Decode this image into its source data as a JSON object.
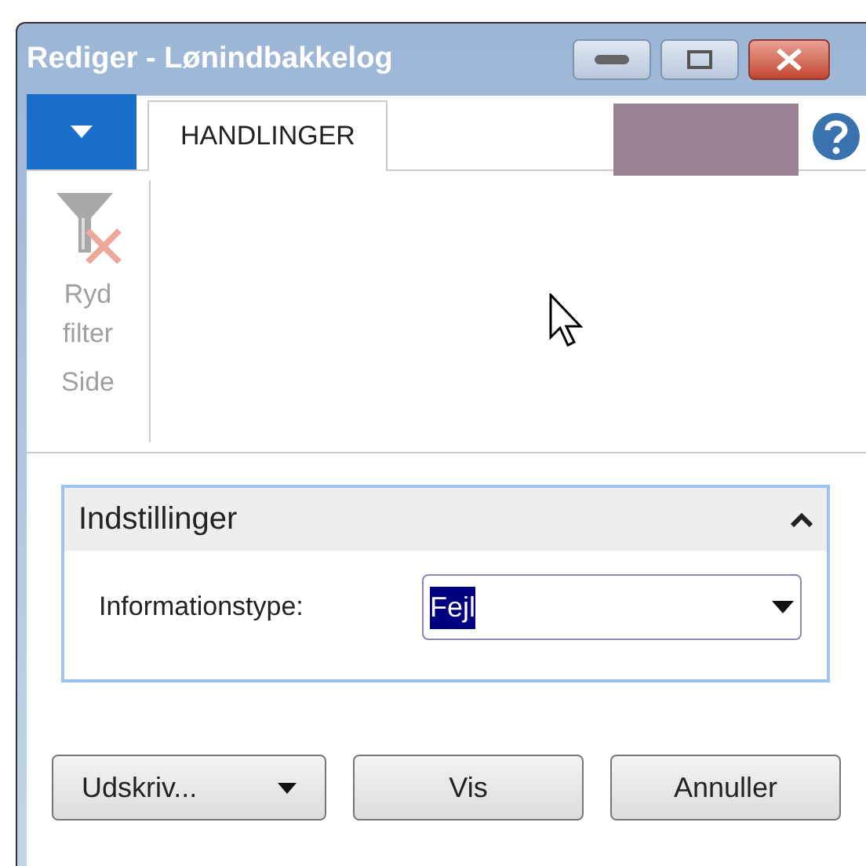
{
  "window": {
    "title": "Rediger - Lønindbakkelog"
  },
  "tabs": [
    {
      "label": "HANDLINGER",
      "selected": true
    }
  ],
  "ribbon": {
    "groups": [
      {
        "label": "Side",
        "actions": [
          {
            "label": "Ryd filter",
            "disabled": true
          }
        ]
      }
    ]
  },
  "section": {
    "title": "Indstillinger",
    "expanded": true,
    "fields": [
      {
        "label": "Informationstype:",
        "value": "Fejl",
        "selected_text": true
      }
    ]
  },
  "buttons": [
    {
      "label": "Udskriv...",
      "kind": "dropdown"
    },
    {
      "label": "Vis",
      "kind": "plain"
    },
    {
      "label": "Annuller",
      "kind": "plain"
    }
  ]
}
